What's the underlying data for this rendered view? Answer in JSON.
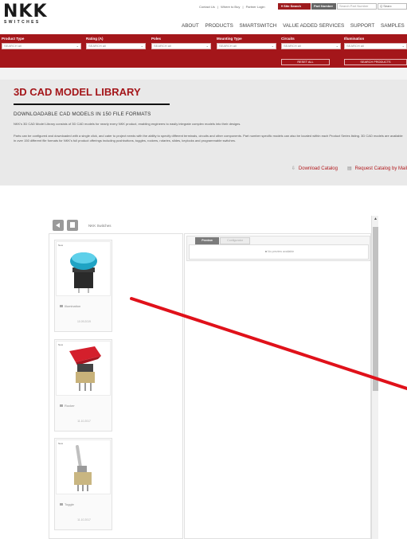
{
  "header": {
    "logo_text": "NKK",
    "logo_sub": "SWITCHES",
    "util_links": [
      "Contact Us",
      "|",
      "Where to Buy",
      "|",
      "Partner Login"
    ],
    "site_search_label": "▾ Site Search",
    "part_number_label": "Part Number",
    "search_placeholder": "Search Part Number",
    "search_go_label": "Q Searc",
    "nav": [
      "ABOUT",
      "PRODUCTS",
      "SMARTSWITCH",
      "VALUE ADDED SERVICES",
      "SUPPORT",
      "SAMPLES"
    ]
  },
  "filters": {
    "columns": [
      {
        "label": "Product Type",
        "value": "SEARCH all"
      },
      {
        "label": "Rating (A)",
        "value": "SEARCH all"
      },
      {
        "label": "Poles",
        "value": "SEARCH all"
      },
      {
        "label": "Mounting Type",
        "value": "SEARCH all"
      },
      {
        "label": "Circuits",
        "value": "SEARCH all"
      },
      {
        "label": "Illumination",
        "value": "SEARCH all"
      }
    ],
    "reset_label": "RESET ALL",
    "search_products_label": "SEARCH PRODUCTS"
  },
  "content": {
    "title": "3D CAD MODEL LIBRARY",
    "subtitle": "DOWNLOADABLE CAD MODELS IN 150 FILE FORMATS",
    "para1": "NKK's 3D CAD Model Library consists of 3D CAD models for nearly every NKK product, enabling engineers to easily integrate complex models into their designs.",
    "para2": "Parts can be configured and downloaded with a single click, and cater to project needs with the ability to specify different terminals, circuits and other components. Part number specific models can also be located within each Product Series listing. 3D CAD models are available in over 150 different file formats for NKK's full product offerings including pushbuttons, toggles, rockers, rotaries, slides, keylocks and programmable switches.",
    "download_catalog": "Download Catalog",
    "request_catalog": "Request Catalog by Mail"
  },
  "widget": {
    "breadcrumb": "NKK Switches",
    "cards": [
      {
        "tag": "New",
        "label": "Illumination",
        "date": "10.09.2019"
      },
      {
        "tag": "New",
        "label": "Rocker",
        "date": "11.10.2017"
      },
      {
        "tag": "New",
        "label": "Toggle",
        "date": "11.10.2017"
      }
    ],
    "tab_preview": "Preview",
    "tab_configurator": "Configurator",
    "no_preview": "No preview available"
  },
  "colors": {
    "brand_red": "#a4161a",
    "arrow_red": "#e0111a"
  }
}
